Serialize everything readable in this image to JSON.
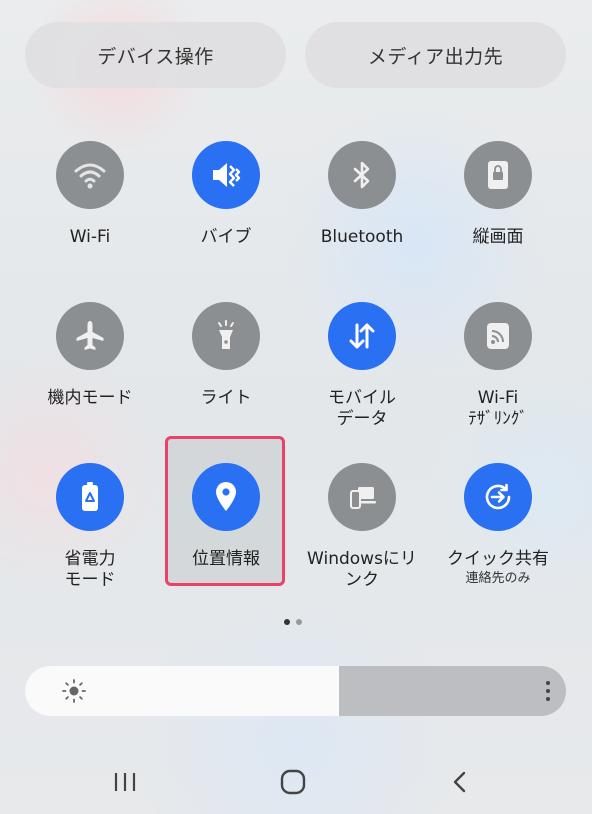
{
  "top_buttons": {
    "device_control": "デバイス操作",
    "media_output": "メディア出力先"
  },
  "tiles": [
    {
      "label": "Wi-Fi",
      "sub": "",
      "icon": "wifi-icon",
      "state": "off"
    },
    {
      "label": "バイブ",
      "sub": "",
      "icon": "vibrate-icon",
      "state": "on"
    },
    {
      "label": "Bluetooth",
      "sub": "",
      "icon": "bluetooth-icon",
      "state": "off"
    },
    {
      "label": "縦画面",
      "sub": "",
      "icon": "portrait-lock-icon",
      "state": "off"
    },
    {
      "label": "機内モード",
      "sub": "",
      "icon": "airplane-icon",
      "state": "off"
    },
    {
      "label": "ライト",
      "sub": "",
      "icon": "flashlight-icon",
      "state": "off"
    },
    {
      "label": "モバイル\nデータ",
      "sub": "",
      "icon": "mobile-data-icon",
      "state": "on"
    },
    {
      "label": "Wi-Fi\nﾃｻﾞﾘﾝｸﾞ",
      "sub": "",
      "icon": "wifi-tethering-icon",
      "state": "off"
    },
    {
      "label": "省電力\nモード",
      "sub": "",
      "icon": "power-saving-icon",
      "state": "on"
    },
    {
      "label": "位置情報",
      "sub": "",
      "icon": "location-icon",
      "state": "on"
    },
    {
      "label": "Windowsにリ\nンク",
      "sub": "",
      "icon": "link-to-windows-icon",
      "state": "off"
    },
    {
      "label": "クイック共有",
      "sub": "連絡先のみ",
      "icon": "quick-share-icon",
      "state": "on"
    }
  ],
  "pager": {
    "pages": 2,
    "current": 1
  },
  "brightness": {
    "level": 0.58
  },
  "colors": {
    "accent": "#2a70f2",
    "tile_off": "#8c8f91",
    "highlight": "#e8416a"
  }
}
